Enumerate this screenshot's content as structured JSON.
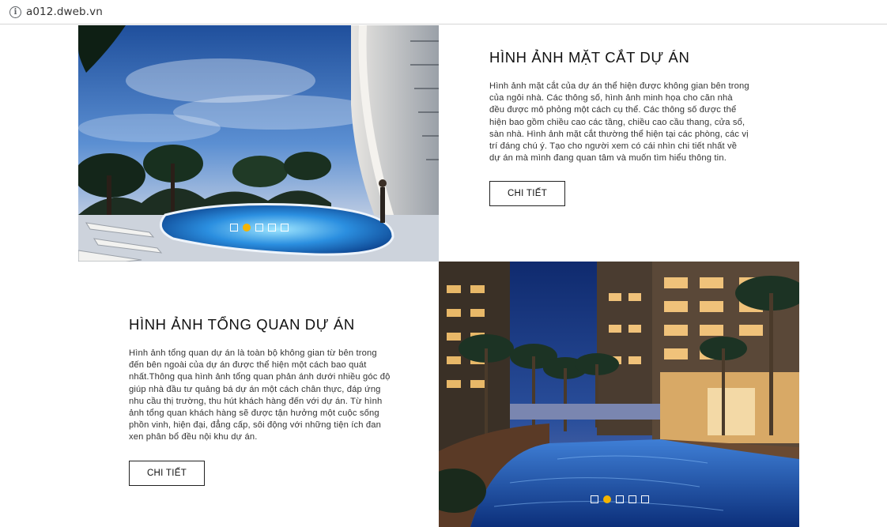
{
  "browser": {
    "url": "a012.dweb.vn"
  },
  "sections": [
    {
      "heading": "HÌNH ẢNH MẶT CẮT DỰ ÁN",
      "body": "Hình ảnh mặt cắt của dự án thể hiện được không gian bên trong của ngôi nhà. Các thông số, hình ảnh minh họa cho căn nhà đều được mô phỏng một cách cụ thể. Các thông số được thể hiện bao gồm chiều cao các tầng, chiều cao cầu thang, cửa sổ, sàn nhà. Hình ảnh mặt cắt thường thể hiện tại các phòng, các vị trí đáng chú ý. Tạo cho người xem có cái nhìn chi tiết nhất về dự án mà mình đang quan tâm và muốn tìm hiểu thông tin.",
      "button": "CHI TIẾT",
      "image": "tropical-resort-pool-tower-image",
      "slider_dots": 5,
      "active_dot": 2
    },
    {
      "heading": "HÌNH ẢNH TỔNG QUAN DỰ ÁN",
      "body": "Hình ảnh tổng quan dự án là toàn bộ không gian từ bên trong đến bên ngoài của dự án được thể hiện một cách bao quát nhất.Thông qua hình ảnh tổng quan phản ánh dưới nhiều góc độ giúp nhà đầu tư quảng bá dự án một cách chân thực, đáp ứng nhu cầu thị trường, thu hút khách hàng đến với dự án. Từ hình ảnh tổng quan khách hàng sẽ được tận hưởng một cuộc sống phồn vinh, hiện đại, đẳng cấp, sôi động với những tiện ích đan xen phân bổ đều nội khu dự án.",
      "button": "CHI TIẾT",
      "image": "night-apartment-pool-image",
      "slider_dots": 5,
      "active_dot": 2
    }
  ],
  "colors": {
    "active_dot": "#f4b400",
    "button_border": "#222222",
    "heading": "#111111"
  }
}
